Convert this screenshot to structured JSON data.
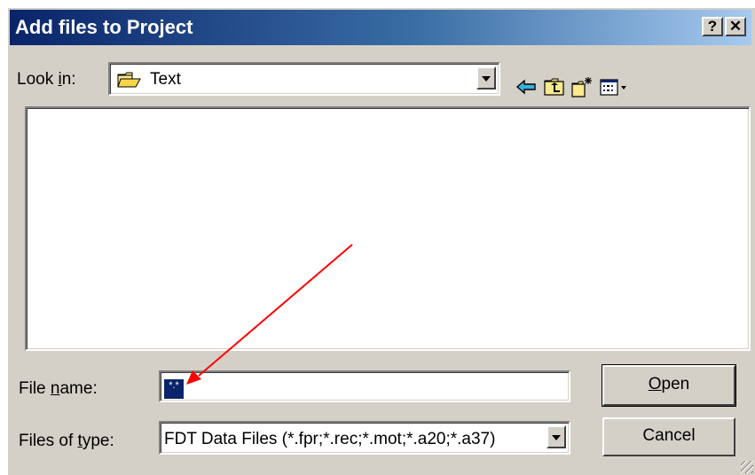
{
  "dialog": {
    "title": "Add files to Project",
    "help_label": "?",
    "close_label": "✕"
  },
  "look_in": {
    "label_pre": "Look ",
    "label_hotkey": "i",
    "label_post": "n:",
    "value": "Text"
  },
  "file_name": {
    "label_pre": "File ",
    "label_hotkey": "n",
    "label_post": "ame:",
    "value": "*.*"
  },
  "files_of_type": {
    "label_pre": "Files of ",
    "label_hotkey": "t",
    "label_post": "ype:",
    "value": "FDT Data Files (*.fpr;*.rec;*.mot;*.a20;*.a37)"
  },
  "buttons": {
    "open_hotkey": "O",
    "open_rest": "pen",
    "cancel": "Cancel"
  },
  "icons": [
    "folder-icon",
    "back-arrow-icon",
    "up-one-level-icon",
    "create-new-folder-icon",
    "view-menu-icon",
    "dropdown-arrow-icon",
    "annotation-arrow"
  ],
  "colors": {
    "titlebar_start": "#0a246a",
    "titlebar_end": "#a6caf0",
    "face": "#d4d0c8",
    "selection": "#0a246a",
    "annotation": "#ff0000"
  }
}
